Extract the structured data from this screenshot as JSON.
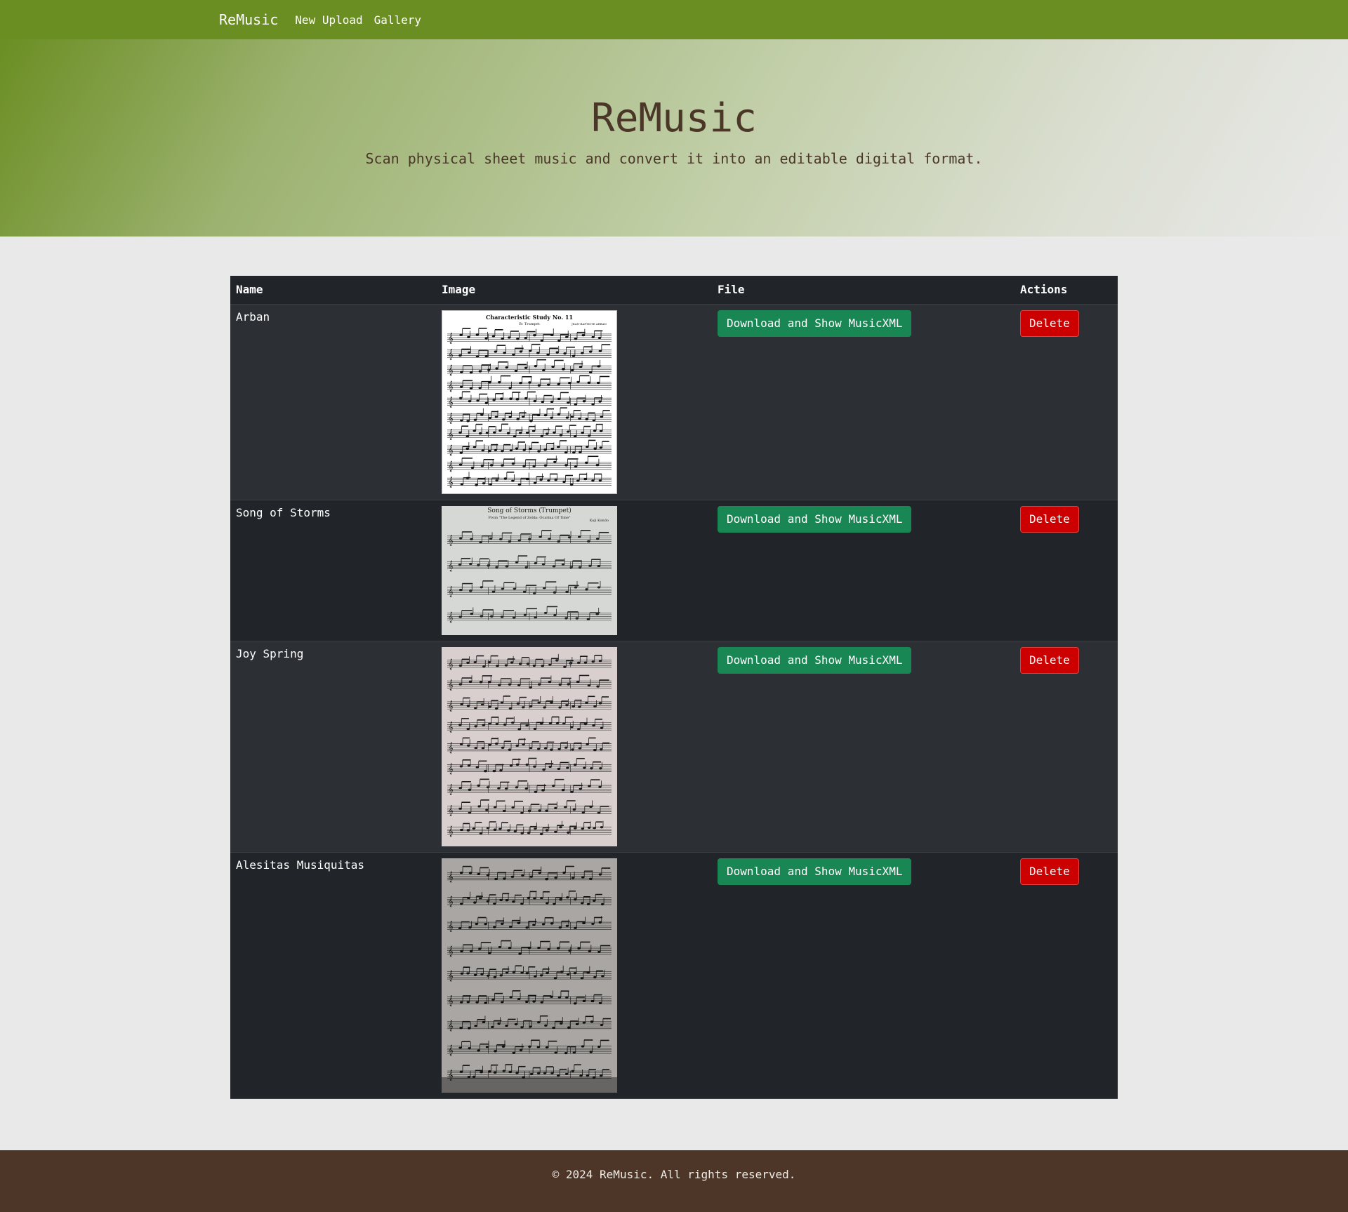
{
  "navbar": {
    "brand": "ReMusic",
    "links": [
      {
        "label": "New Upload"
      },
      {
        "label": "Gallery"
      }
    ],
    "bg_color": "#6b8e23"
  },
  "hero": {
    "title": "ReMusic",
    "subtitle": "Scan physical sheet music and convert it into an editable digital format."
  },
  "table": {
    "headers": {
      "name": "Name",
      "image": "Image",
      "file": "File",
      "actions": "Actions"
    },
    "rows": [
      {
        "name": "Arban",
        "image": {
          "title": "Characteristic Study No. 11",
          "subtitle": "B♭ Trumpet",
          "composer": "JEAN-BAPTISTE ARBAN",
          "style": "clean-white"
        },
        "download_label": "Download and Show MusicXML",
        "delete_label": "Delete"
      },
      {
        "name": "Song of Storms",
        "image": {
          "title": "Song of Storms (Trumpet)",
          "subtitle": "From \"The Legend of Zelda: Ocarina Of Time\"",
          "composer": "Koji Kondo",
          "style": "gray-photo"
        },
        "download_label": "Download and Show MusicXML",
        "delete_label": "Delete"
      },
      {
        "name": "Joy Spring",
        "image": {
          "title": "",
          "subtitle": "",
          "composer": "",
          "style": "handwritten-lead-sheet"
        },
        "download_label": "Download and Show MusicXML",
        "delete_label": "Delete"
      },
      {
        "name": "Alesitas Musiquitas",
        "image": {
          "title": "",
          "subtitle": "",
          "composer": "",
          "style": "handwritten-lead-sheet-dark"
        },
        "download_label": "Download and Show MusicXML",
        "delete_label": "Delete"
      }
    ]
  },
  "footer": {
    "text": "© 2024 ReMusic. All rights reserved.",
    "bg_color": "#4d3528"
  },
  "colors": {
    "success": "#198754",
    "danger": "#cc0000",
    "table_dark": "#212529",
    "table_dark_alt": "#2c3035",
    "hero_text": "#4a3728"
  }
}
